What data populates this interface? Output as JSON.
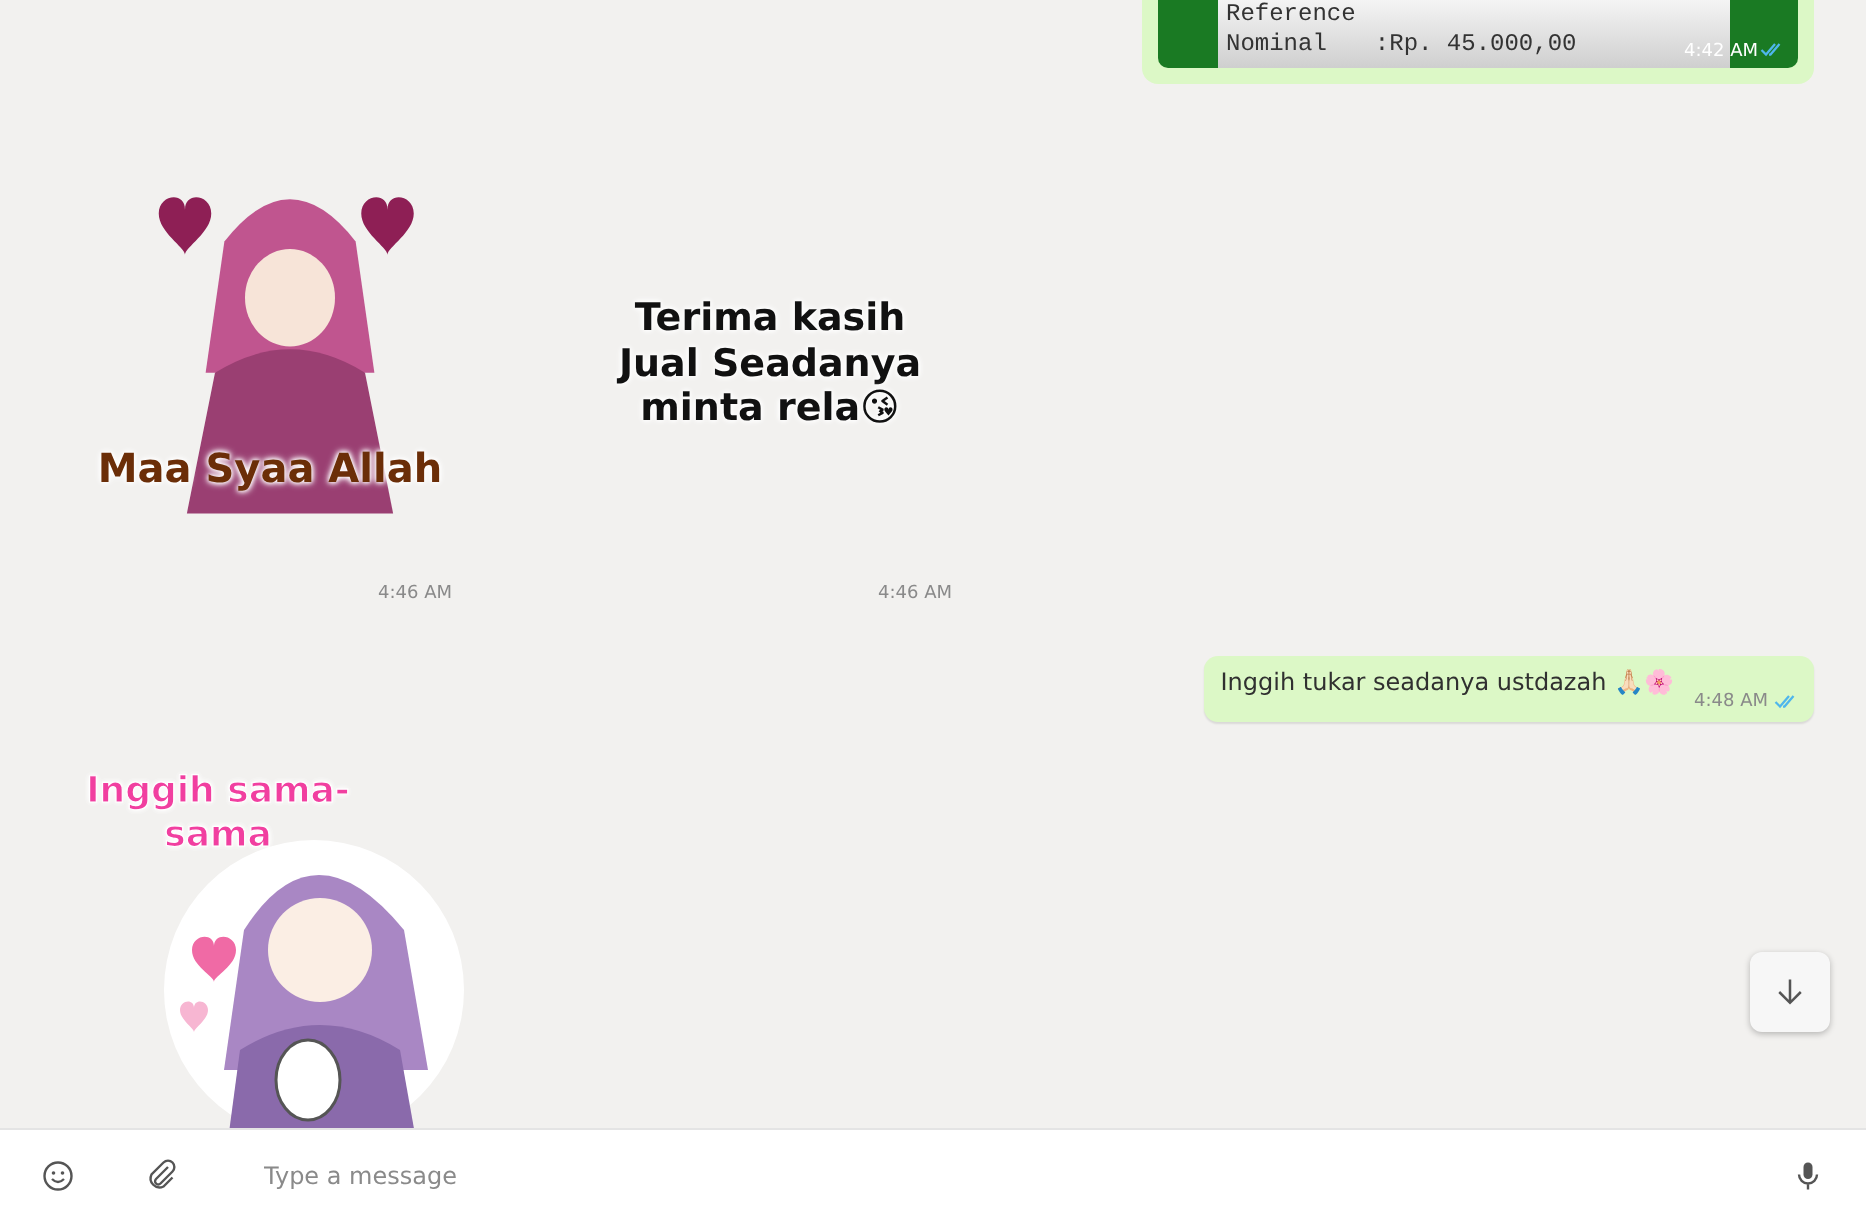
{
  "messages": [
    {
      "kind": "receipt",
      "lines": [
        {
          "label": "Reference"
        },
        {
          "label": "Nominal",
          "value": ":Rp. 45.000,00"
        }
      ],
      "time": "4:42 AM",
      "read": true
    },
    {
      "kind": "sticker_row",
      "stickers": [
        {
          "caption": "Maa Syaa Allah",
          "kind": "figure",
          "time": "4:46 AM"
        },
        {
          "caption": "Terima kasih Jual Seadanya minta rela😘",
          "kind": "text",
          "time": "4:46 AM"
        }
      ]
    },
    {
      "kind": "text",
      "text": "Inggih tukar seadanya ustdazah 🙏🏻🌸",
      "time": "4:48 AM",
      "read": true
    },
    {
      "kind": "sticker",
      "caption": "Inggih sama-sama"
    }
  ],
  "composer": {
    "placeholder": "Type a message"
  }
}
